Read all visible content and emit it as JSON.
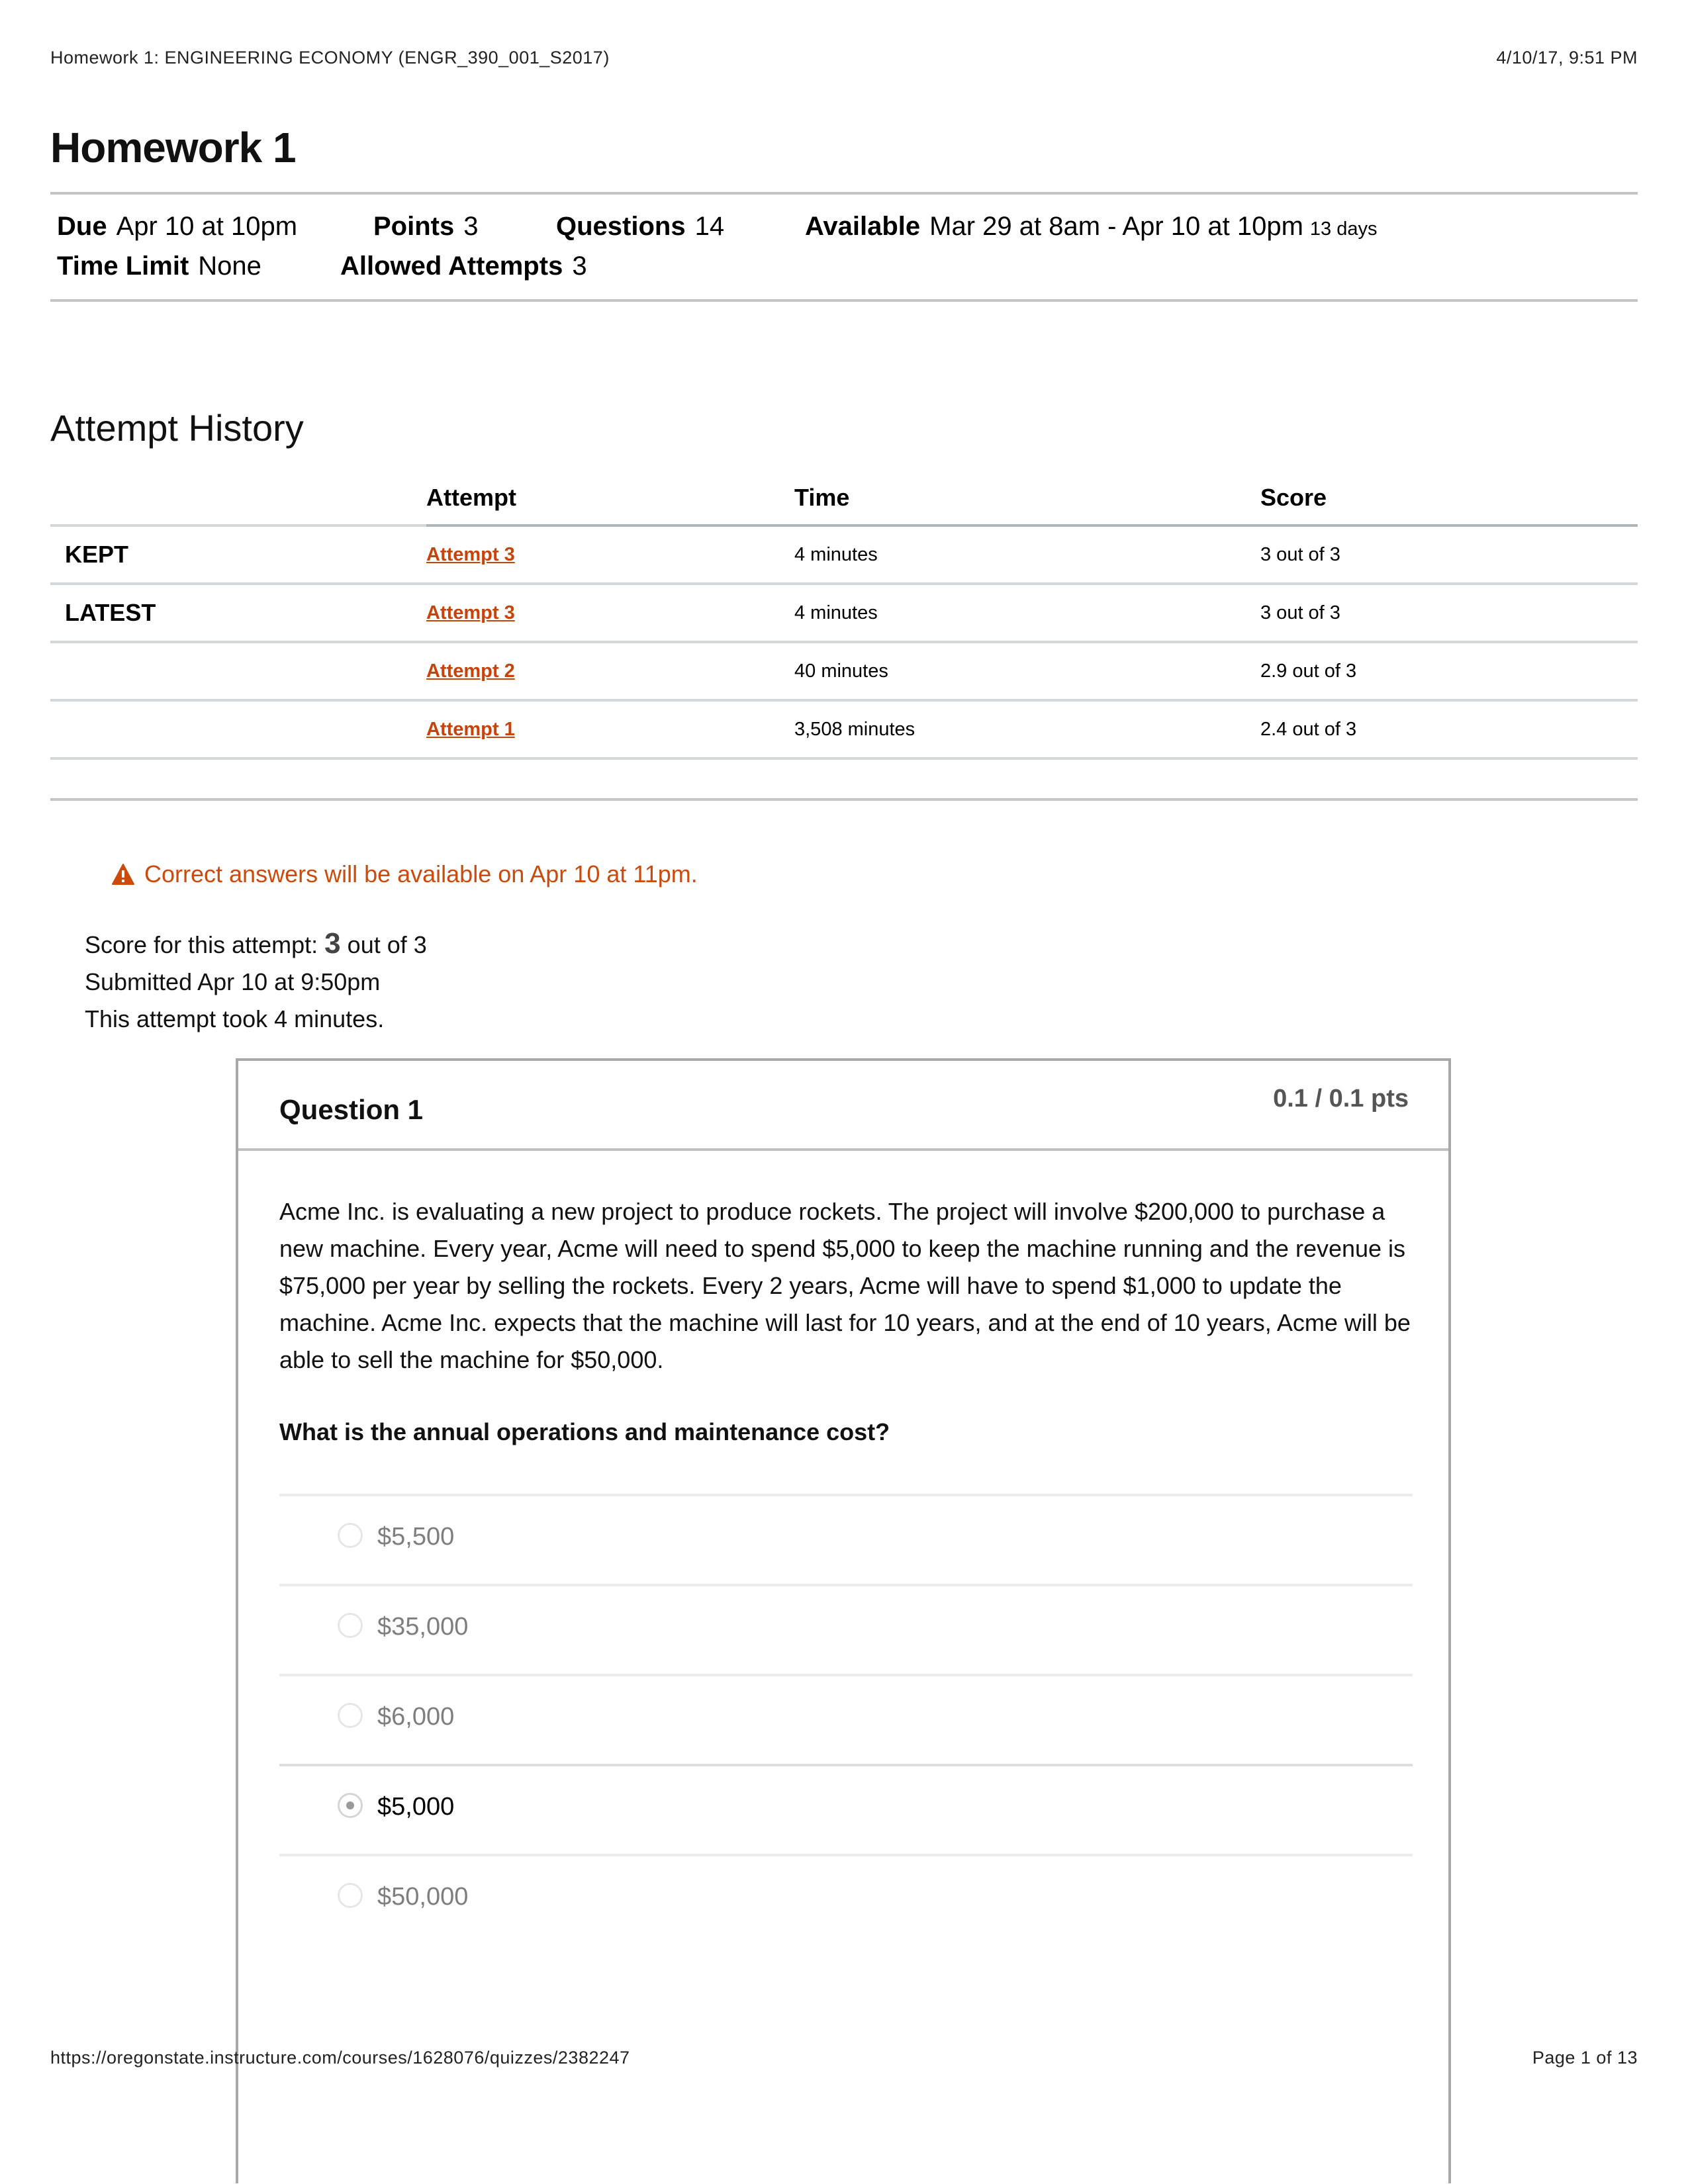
{
  "print_header": {
    "title": "Homework 1: ENGINEERING ECONOMY (ENGR_390_001_S2017)",
    "datetime": "4/10/17, 9:51 PM"
  },
  "page_title": "Homework 1",
  "quiz_meta": {
    "due": {
      "label": "Due",
      "value": "Apr 10 at 10pm"
    },
    "points": {
      "label": "Points",
      "value": "3"
    },
    "questions": {
      "label": "Questions",
      "value": "14"
    },
    "available": {
      "label": "Available",
      "value": "Mar 29 at 8am - Apr 10 at 10pm",
      "duration": "13 days"
    },
    "time_limit": {
      "label": "Time Limit",
      "value": "None"
    },
    "allowed_attempts": {
      "label": "Allowed Attempts",
      "value": "3"
    }
  },
  "attempt_history": {
    "title": "Attempt History",
    "columns": [
      "",
      "Attempt",
      "Time",
      "Score"
    ],
    "rows": [
      {
        "tag": "KEPT",
        "attempt": "Attempt 3",
        "time": "4 minutes",
        "score": "3 out of 3"
      },
      {
        "tag": "LATEST",
        "attempt": "Attempt 3",
        "time": "4 minutes",
        "score": "3 out of 3"
      },
      {
        "tag": "",
        "attempt": "Attempt 2",
        "time": "40 minutes",
        "score": "2.9 out of 3"
      },
      {
        "tag": "",
        "attempt": "Attempt 1",
        "time": "3,508 minutes",
        "score": "2.4 out of 3"
      }
    ]
  },
  "notice": {
    "icon": "warning-icon",
    "text": "Correct answers will be available on Apr 10 at 11pm.",
    "color": "#cc4a0a"
  },
  "attempt_summary": {
    "score_prefix": "Score for this attempt:",
    "score_value": "3",
    "score_suffix": "out of 3",
    "submitted": "Submitted Apr 10 at 9:50pm",
    "duration": "This attempt took 4 minutes."
  },
  "question": {
    "title": "Question 1",
    "points": "0.1 / 0.1 pts",
    "body": "Acme Inc. is evaluating a new project to produce rockets. The project will involve $200,000 to purchase a new machine. Every year, Acme will need to spend $5,000 to keep the machine running and the revenue is $75,000 per year by selling the rockets. Every 2 years, Acme will have to spend $1,000 to update the machine. Acme Inc. expects that the machine will last for 10 years, and at the end of 10 years, Acme will be able to sell the machine for $50,000.",
    "prompt": "What is the annual operations and maintenance cost?",
    "answers": [
      {
        "label": "$5,500",
        "selected": false
      },
      {
        "label": "$35,000",
        "selected": false
      },
      {
        "label": "$6,000",
        "selected": false
      },
      {
        "label": "$5,000",
        "selected": true
      },
      {
        "label": "$50,000",
        "selected": false
      }
    ]
  },
  "print_footer": {
    "url": "https://oregonstate.instructure.com/courses/1628076/quizzes/2382247",
    "page": "Page 1 of 13"
  }
}
